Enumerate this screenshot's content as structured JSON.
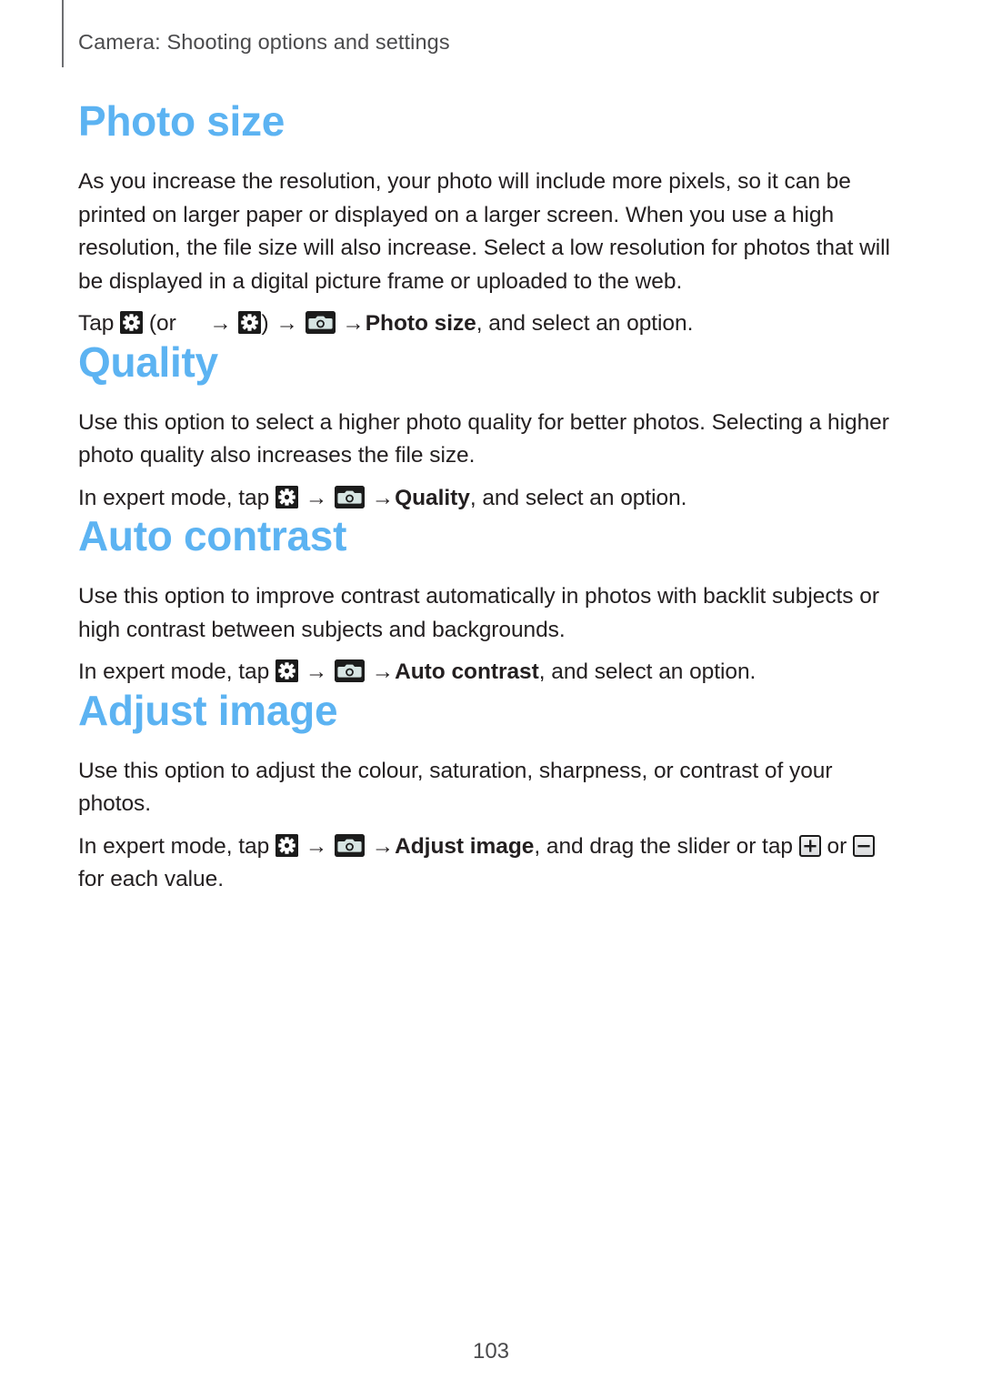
{
  "header": {
    "running_title": "Camera: Shooting options and settings"
  },
  "theme": {
    "heading_color": "#5cb3f2",
    "body_color": "#231f20",
    "header_color": "#4a4a4c",
    "page_background": "#ffffff"
  },
  "sections": [
    {
      "id": "photo-size",
      "title": "Photo size",
      "paragraphs": [
        "As you increase the resolution, your photo will include more pixels, so it can be printed on larger paper or displayed on a larger screen. When you use a high resolution, the file size will also increase. Select a low resolution for photos that will be displayed in a digital picture frame or uploaded to the web."
      ],
      "path": {
        "lead": "Tap",
        "open_paren": "(or",
        "close_paren": ")",
        "option": "Photo size",
        "tail": ", and select an option.",
        "arrow": "→"
      }
    },
    {
      "id": "quality",
      "title": "Quality",
      "paragraphs": [
        "Use this option to select a higher photo quality for better photos. Selecting a higher photo quality also increases the file size."
      ],
      "path": {
        "lead": "In expert mode, tap",
        "option": "Quality",
        "tail": ", and select an option.",
        "arrow": "→"
      }
    },
    {
      "id": "auto-contrast",
      "title": "Auto contrast",
      "paragraphs": [
        "Use this option to improve contrast automatically in photos with backlit subjects or high contrast between subjects and backgrounds."
      ],
      "path": {
        "lead": "In expert mode, tap",
        "option": "Auto contrast",
        "tail": ", and select an option.",
        "arrow": "→"
      }
    },
    {
      "id": "adjust-image",
      "title": "Adjust image",
      "paragraphs": [
        "Use this option to adjust the colour, saturation, sharpness, or contrast of your photos."
      ],
      "path": {
        "lead": "In expert mode, tap",
        "option": "Adjust image",
        "mid": ", and drag the slider or tap",
        "or": "or",
        "tail": "for each value.",
        "arrow": "→"
      }
    }
  ],
  "icons": {
    "settings": "settings-gear-icon",
    "camera": "camera-icon",
    "plus": "plus-stepper-icon",
    "minus": "minus-stepper-icon"
  },
  "footer": {
    "page_number": "103"
  }
}
